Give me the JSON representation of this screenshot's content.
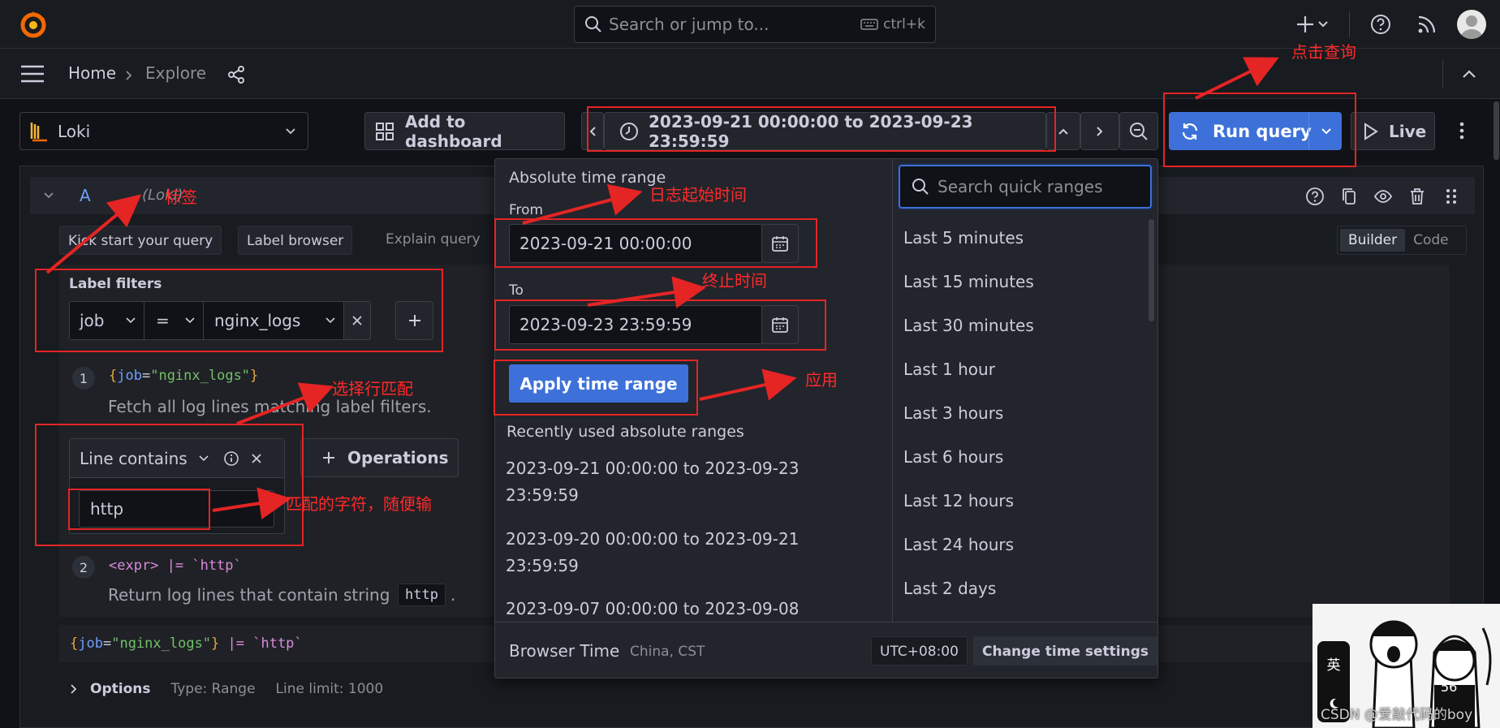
{
  "topbar": {
    "search_placeholder": "Search or jump to...",
    "shortcut": "ctrl+k"
  },
  "breadcrumb": {
    "home": "Home",
    "current": "Explore"
  },
  "toolbar": {
    "datasource": "Loki",
    "add_to_dashboard": "Add to dashboard",
    "time_range": "2023-09-21 00:00:00 to 2023-09-23 23:59:59",
    "run_query": "Run query",
    "live": "Live"
  },
  "query": {
    "ref_id": "A",
    "ds_label": "(Loki)",
    "kick_start": "Kick start your query",
    "label_browser": "Label browser",
    "explain_query": "Explain query",
    "mode_builder": "Builder",
    "mode_code": "Code",
    "label_filters_title": "Label filters",
    "filter_label": "job",
    "filter_op": "=",
    "filter_value": "nginx_logs",
    "step1_num": "1",
    "step1_code_pre": "{",
    "step1_code_key": "job",
    "step1_code_eq": "=",
    "step1_code_val": "\"nginx_logs\"",
    "step1_code_post": "}",
    "step1_desc": "Fetch all log lines matching label filters.",
    "op_title": "Line contains",
    "op_value": "http",
    "operations": "Operations",
    "step2_num": "2",
    "step2_code": "<expr> |= `http`",
    "step2_desc": "Return log lines that contain string",
    "step2_chip": "http",
    "step2_dot": ".",
    "raw_pre": "{",
    "raw_key": "job",
    "raw_eq": "=",
    "raw_val": "\"nginx_logs\"",
    "raw_post": "}",
    "raw_pipe": " |= `http`",
    "options_label": "Options",
    "options_type": "Type: Range",
    "options_limit": "Line limit: 1000"
  },
  "picker": {
    "title": "Absolute time range",
    "from_label": "From",
    "from_value": "2023-09-21 00:00:00",
    "to_label": "To",
    "to_value": "2023-09-23 23:59:59",
    "apply": "Apply time range",
    "recent_title": "Recently used absolute ranges",
    "recent": [
      "2023-09-21 00:00:00 to 2023-09-23 23:59:59",
      "2023-09-20 00:00:00 to 2023-09-21 23:59:59",
      "2023-09-07 00:00:00 to 2023-09-08"
    ],
    "search_placeholder": "Search quick ranges",
    "quick": [
      "Last 5 minutes",
      "Last 15 minutes",
      "Last 30 minutes",
      "Last 1 hour",
      "Last 3 hours",
      "Last 6 hours",
      "Last 12 hours",
      "Last 24 hours",
      "Last 2 days"
    ],
    "browser_time": "Browser Time",
    "browser_loc": "China, CST",
    "utc": "UTC+08:00",
    "change_settings": "Change time settings"
  },
  "annotations": {
    "label": "标签",
    "start_time": "日志起始时间",
    "end_time": "终止时间",
    "apply": "应用",
    "click_query": "点击查询",
    "line_match": "选择行匹配",
    "match_chars": "匹配的字符，随便输"
  },
  "watermark": {
    "text": "CSDN @爱敲代码的boy",
    "lang": "英"
  },
  "colors": {
    "accent": "#3d71d9",
    "annotation": "#e52424"
  }
}
